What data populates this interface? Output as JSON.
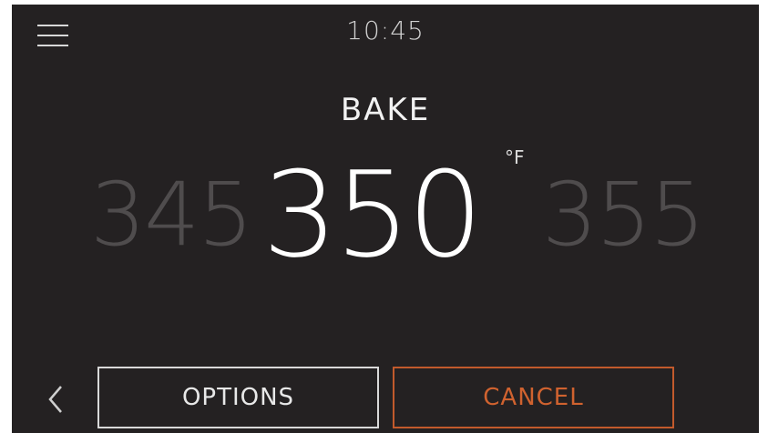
{
  "header": {
    "menu_icon": "hamburger-menu-icon",
    "time": "10:45"
  },
  "main": {
    "mode": "BAKE",
    "temperature": {
      "previous": "345",
      "current": "350",
      "next": "355",
      "unit": "°F"
    }
  },
  "footer": {
    "back_icon": "chevron-left-icon",
    "options_label": "OPTIONS",
    "cancel_label": "CANCEL"
  },
  "colors": {
    "background": "#242122",
    "accent": "#d0622f",
    "dim_text": "#4f4c4d"
  }
}
